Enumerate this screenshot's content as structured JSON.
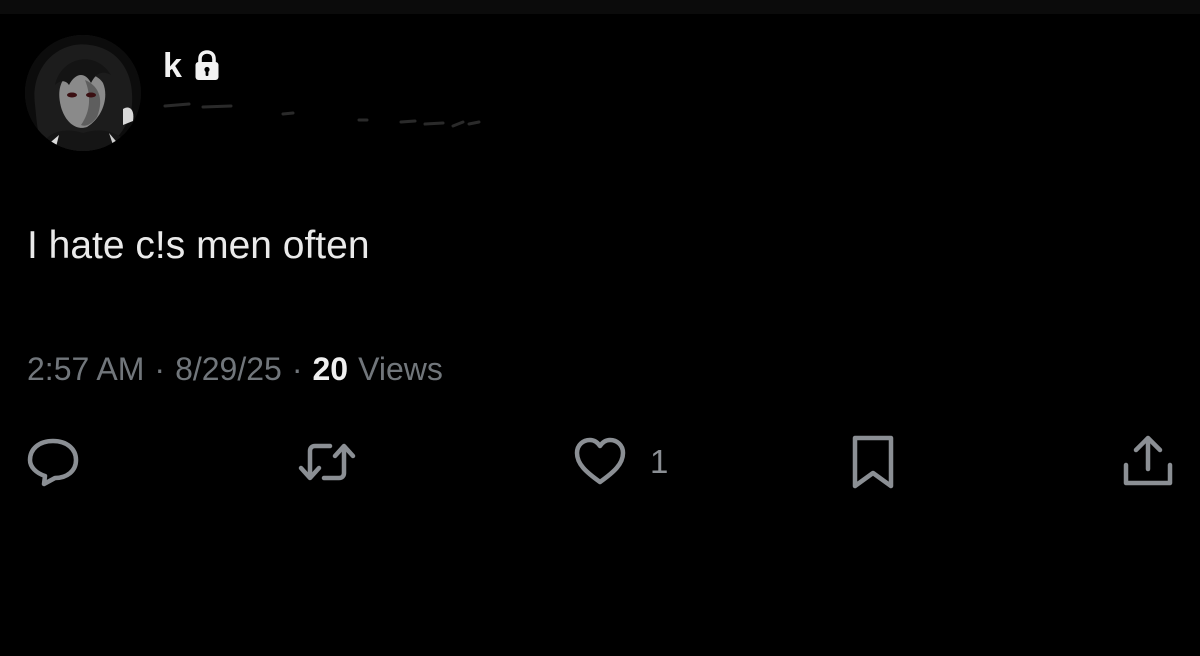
{
  "author": {
    "display_name": "k",
    "protected_icon": "lock-icon",
    "avatar": "dark anime avatar"
  },
  "tweet": {
    "text": "I hate c!s men often"
  },
  "meta": {
    "time": "2:57 AM",
    "separator": "·",
    "date": "8/29/25",
    "views_count": "20",
    "views_label": "Views"
  },
  "actions": {
    "reply_icon": "speech-bubble-icon",
    "retweet_icon": "retweet-icon",
    "like_icon": "heart-icon",
    "like_count": "1",
    "bookmark_icon": "bookmark-icon",
    "share_icon": "share-upload-icon"
  },
  "colors": {
    "background": "#000000",
    "primary_text": "#e7e9ea",
    "secondary_text": "#71767b"
  }
}
